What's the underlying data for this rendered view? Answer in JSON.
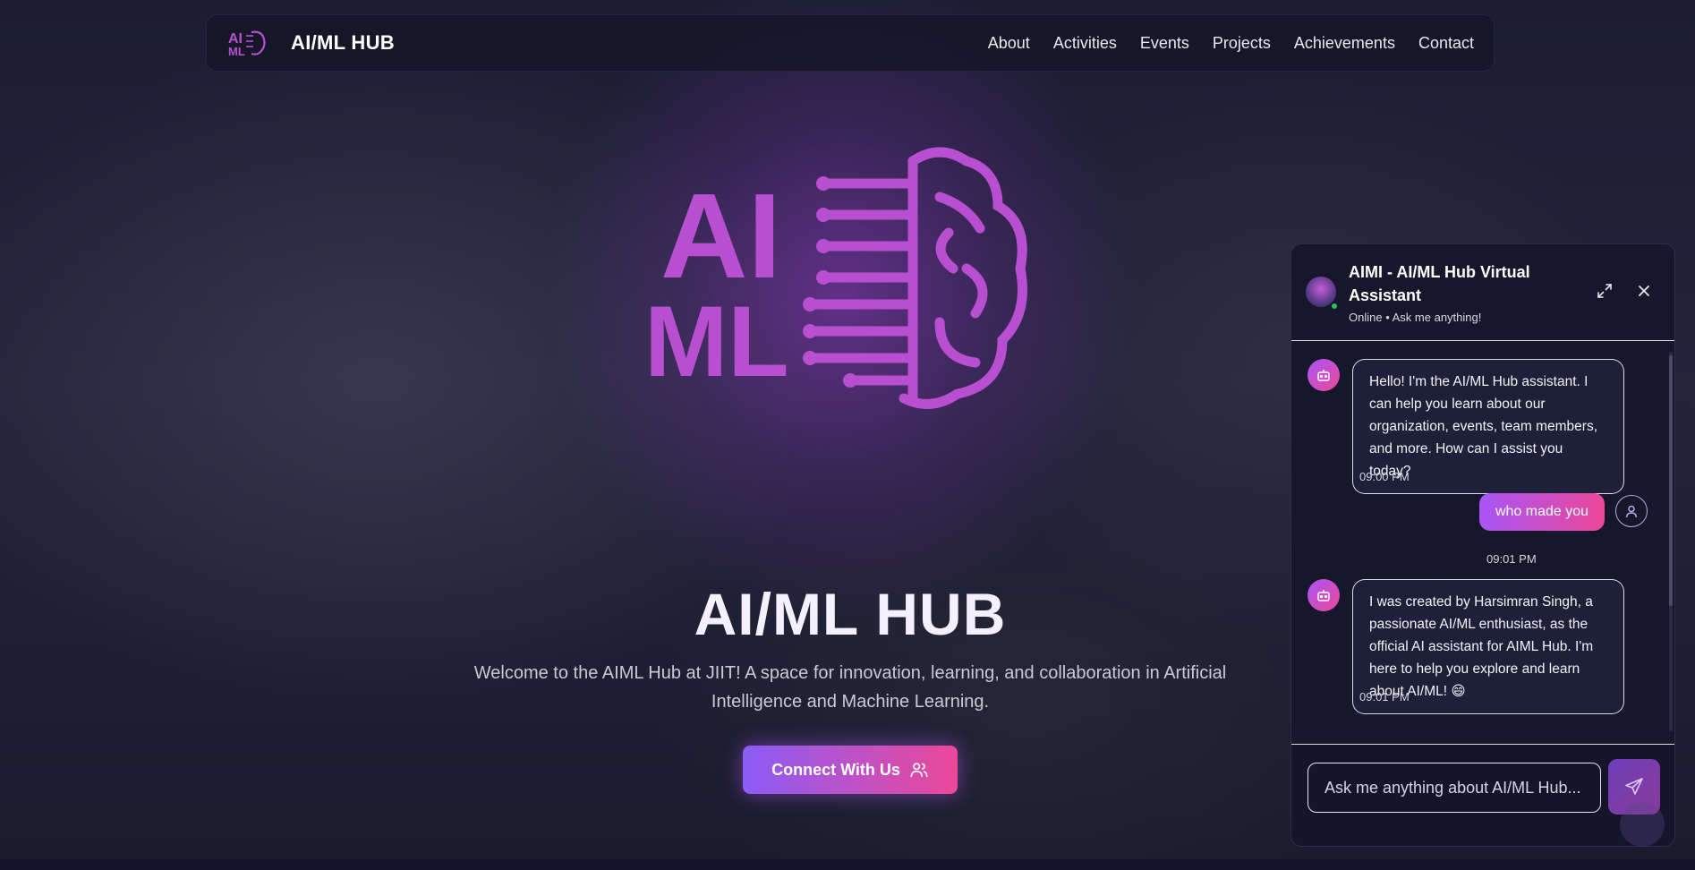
{
  "navbar": {
    "logo_icon": "aiml-brain-logo",
    "brand": "AI/ML HUB",
    "links": [
      "About",
      "Activities",
      "Events",
      "Projects",
      "Achievements",
      "Contact"
    ]
  },
  "hero": {
    "logo_icon": "aiml-brain-logo",
    "title": "AI/ML HUB",
    "description": "Welcome to the AIML Hub at JIIT! A space for innovation, learning, and collaboration in Artificial Intelligence and Machine Learning.",
    "cta_label": "Connect With Us",
    "cta_icon": "users-icon"
  },
  "chat": {
    "title": "AIMI - AI/ML Hub Virtual Assistant",
    "status": "Online • Ask me anything!",
    "expand_icon": "expand-icon",
    "close_icon": "close-icon",
    "messages": [
      {
        "sender": "bot",
        "text": "Hello! I'm the AI/ML Hub assistant. I can help you learn about our organization, events, team members, and more. How can I assist you today?",
        "time": "09:00 PM"
      },
      {
        "sender": "user",
        "text": "who made you",
        "time": "09:01 PM"
      },
      {
        "sender": "bot",
        "text": "I was created by Harsimran Singh, a passionate AI/ML enthusiast, as the official AI assistant for AIML Hub. I'm here to help you explore and learn about AI/ML! 😄",
        "time": "09:01 PM"
      }
    ],
    "input_placeholder": "Ask me anything about AI/ML Hub...",
    "send_icon": "send-icon"
  },
  "colors": {
    "accent_purple": "#a855f7",
    "accent_pink": "#ec4899",
    "logo_magenta": "#b84fd0",
    "online_green": "#22c55e"
  }
}
